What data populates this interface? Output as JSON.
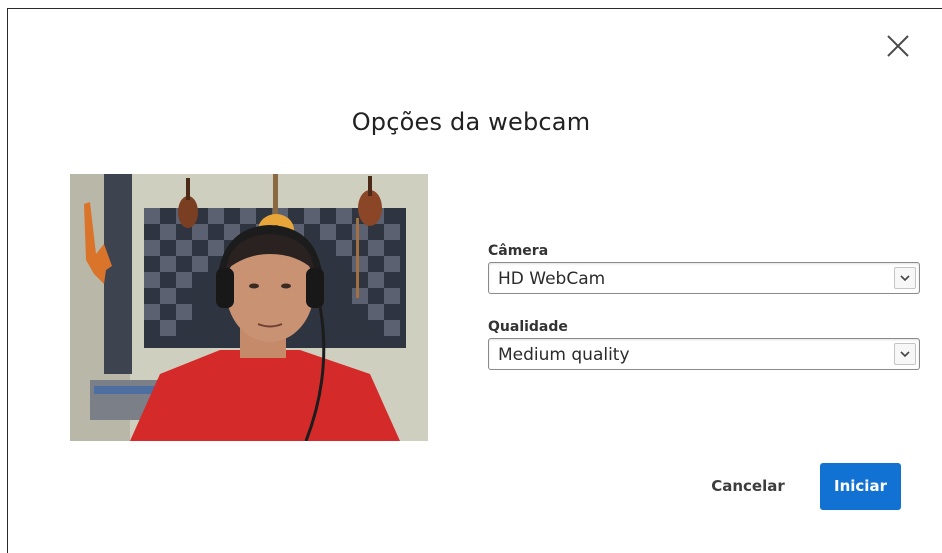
{
  "dialog": {
    "title": "Opções da webcam",
    "close_icon": "close-icon"
  },
  "preview": {
    "icon": "webcam-preview-image"
  },
  "form": {
    "camera": {
      "label": "Câmera",
      "value": "HD WebCam"
    },
    "quality": {
      "label": "Qualidade",
      "value": "Medium quality"
    }
  },
  "actions": {
    "cancel_label": "Cancelar",
    "start_label": "Iniciar"
  },
  "colors": {
    "primary": "#1272d3",
    "text": "#222222"
  }
}
